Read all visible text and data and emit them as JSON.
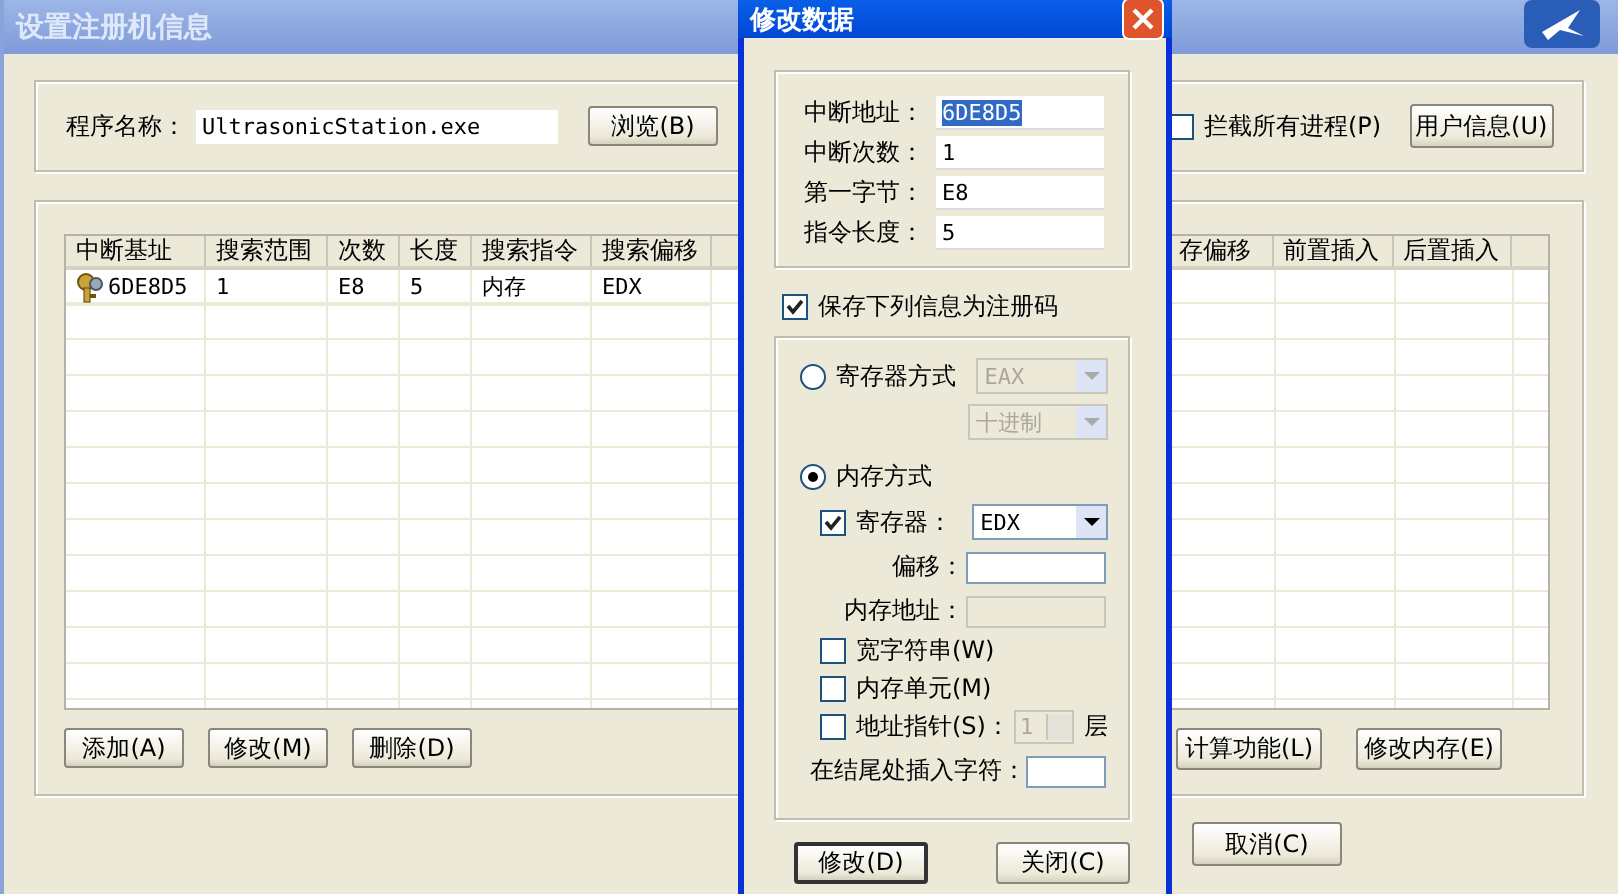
{
  "main_window": {
    "title": "设置注册机信息"
  },
  "program": {
    "label": "程序名称：",
    "value": "UltrasonicStation.exe",
    "browse_button": "浏览(B)",
    "intercept_all": {
      "label": "拦截所有进程(P)",
      "checked": false
    },
    "user_info_button": "用户信息(U)"
  },
  "table": {
    "columns_left": [
      "中断基址",
      "搜索范围",
      "次数",
      "长度",
      "搜索指令",
      "搜索偏移"
    ],
    "columns_right": [
      "存偏移",
      "前置插入",
      "后置插入"
    ],
    "rows": [
      {
        "cells": [
          "6DE8D5",
          "1",
          "E8",
          "5",
          "内存",
          "EDX"
        ]
      }
    ]
  },
  "buttons_left": [
    "添加(A)",
    "修改(M)",
    "删除(D)"
  ],
  "buttons_right": [
    "计算功能(L)",
    "修改内存(E)"
  ],
  "cancel_button": "取消(C)",
  "dialog": {
    "title": "修改数据",
    "fields": [
      {
        "label": "中断地址：",
        "value": "6DE8D5",
        "highlighted": true
      },
      {
        "label": "中断次数：",
        "value": "1",
        "highlighted": false
      },
      {
        "label": "第一字节：",
        "value": "E8",
        "highlighted": false
      },
      {
        "label": "指令长度：",
        "value": "5",
        "highlighted": false
      }
    ],
    "save_checkbox": {
      "label": "保存下列信息为注册码",
      "checked": true
    },
    "register_mode": {
      "label": "寄存器方式",
      "selected": false,
      "register": {
        "value": "EAX",
        "disabled": true
      },
      "base": {
        "value": "十进制",
        "disabled": true
      }
    },
    "memory_mode": {
      "label": "内存方式",
      "selected": true,
      "register": {
        "label": "寄存器：",
        "checked": true,
        "value": "EDX"
      },
      "offset": {
        "label": "偏移："
      },
      "address": {
        "label": "内存地址：",
        "disabled": true
      }
    },
    "options": [
      {
        "kind": "plain",
        "label": "宽字符串(W)",
        "checked": false
      },
      {
        "kind": "plain",
        "label": "内存单元(M)",
        "checked": false
      },
      {
        "kind": "pointer",
        "label": "地址指针(S)：",
        "checked": false,
        "spinner": {
          "value": "1",
          "disabled": true
        },
        "suffix": "层"
      }
    ],
    "insert_field": {
      "label": "在结尾处插入字符："
    },
    "buttons": [
      "修改(D)",
      "关闭(C)"
    ]
  }
}
